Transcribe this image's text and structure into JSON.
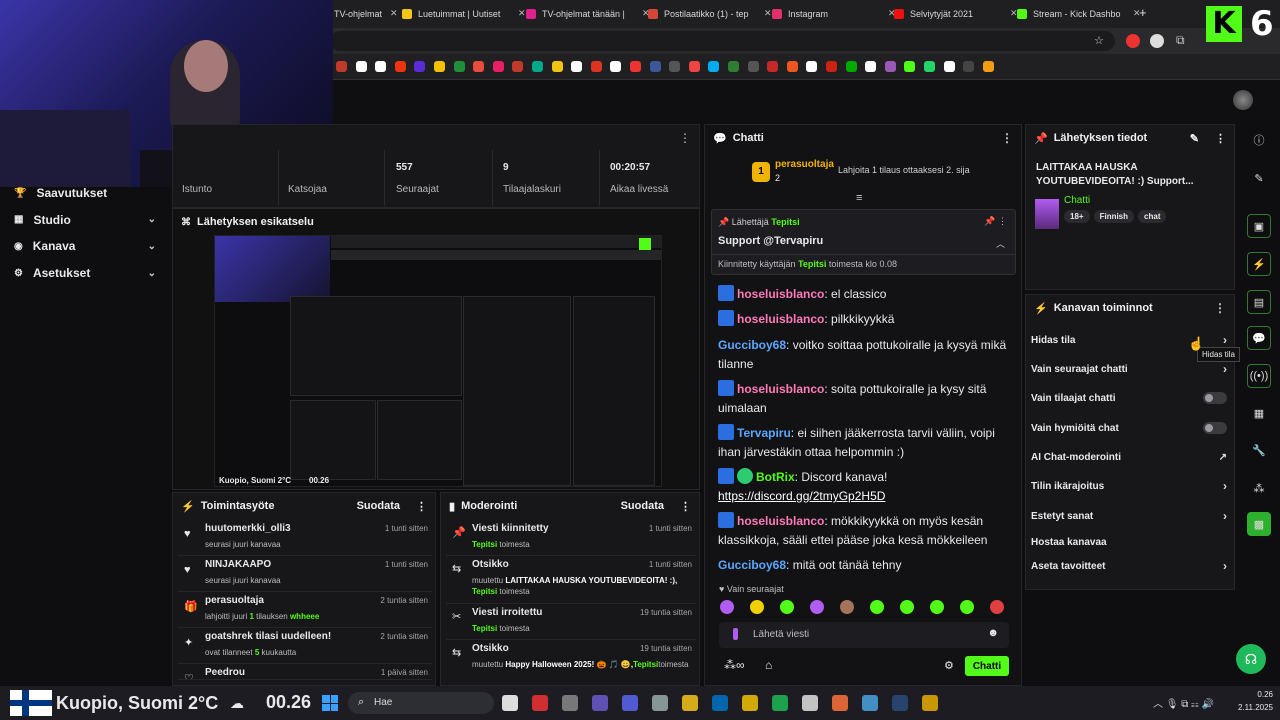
{
  "browser": {
    "tabs": [
      {
        "label": "TV-ohjelmat tänään - Ilta-Sa",
        "color": "#d33"
      },
      {
        "label": "Luetuimmat | Uutiset",
        "color": "#f5c518"
      },
      {
        "label": "TV-ohjelmat tänään |",
        "color": "#e0208c"
      },
      {
        "label": "Postilaatikko (1) - tep",
        "color": "#d44638"
      },
      {
        "label": "Instagram",
        "color": "#e1306c"
      },
      {
        "label": "Selviytyjät 2021",
        "color": "#e11"
      },
      {
        "label": "Stream - Kick Dashbo",
        "color": "#53fc18"
      }
    ],
    "new_tab": "+",
    "bookmark_colors": [
      "#c0392b",
      "#ffffff",
      "#ffffff",
      "#e31",
      "#5b2bd6",
      "#f2c200",
      "#1f8f3a",
      "#e74c3c",
      "#e91e63",
      "#c0392b",
      "#0a8",
      "#f1c40f",
      "#fff",
      "#d32",
      "#fff",
      "#e33",
      "#3b5998",
      "#555",
      "#e44",
      "#00acee",
      "#2e7d32",
      "#555",
      "#c62828",
      "#e52",
      "#fff",
      "#c21",
      "#0a0",
      "#fff",
      "#9b59b6",
      "#53fc18",
      "#25d366",
      "#fff",
      "#444",
      "#f39c12"
    ]
  },
  "kick_logo": "K",
  "kick_six": "6",
  "sidebar": {
    "items": [
      {
        "label": "Saavutukset",
        "icon": "trophy-icon"
      },
      {
        "label": "Studio",
        "icon": "grid-icon"
      },
      {
        "label": "Kanava",
        "icon": "channel-icon"
      },
      {
        "label": "Asetukset",
        "icon": "gear-icon"
      }
    ]
  },
  "stats": [
    {
      "value": "",
      "label": "Istunto"
    },
    {
      "value": "",
      "label": "Katsojaa"
    },
    {
      "value": "557",
      "label": "Seuraajat"
    },
    {
      "value": "9",
      "label": "Tilaajalaskuri"
    },
    {
      "value": "00:20:57",
      "label": "Aikaa livessä"
    }
  ],
  "preview": {
    "title": "Lähetyksen esikatselu",
    "location": "Kuopio, Suomi 2°C",
    "time": "00.26"
  },
  "activity": {
    "title": "Toimintasyöte",
    "filter": "Suodata",
    "rows": [
      {
        "title": "huutomerkki_olli3",
        "sub": "seurasi juuri kanavaa",
        "time": "1 tunti sitten"
      },
      {
        "title": "NINJAKAAPO",
        "sub": "seurasi juuri kanavaa",
        "time": "1 tunti sitten"
      },
      {
        "title": "perasuoltaja",
        "sub_a": "lahjoitti juuri ",
        "sub_b": "1",
        "sub_c": " tilauksen ",
        "sub_d": "whheee",
        "time": "2 tuntia sitten"
      },
      {
        "title": "goatshrek tilasi uudelleen!",
        "sub_a": "ovat tilanneet ",
        "sub_b": "5",
        "sub_c": " kuukautta",
        "time": "2 tuntia sitten"
      },
      {
        "title": "Peedrou",
        "time": "1 päivä sitten"
      }
    ]
  },
  "moderation": {
    "title": "Moderointi",
    "filter": "Suodata",
    "rows": [
      {
        "title": "Viesti kiinnitetty",
        "user": "Tepitsi",
        "suffix": " toimesta",
        "time": "1 tunti sitten"
      },
      {
        "title": "Otsikko",
        "pre": "muutettu ",
        "bold": "LAITTAKAA HAUSKA YOUTUBEVIDEOITA! :),",
        "user": "Tepitsi",
        "suffix": " toimesta",
        "time": "1 tunti sitten"
      },
      {
        "title": "Viesti irroitettu",
        "user": "Tepitsi",
        "suffix": " toimesta",
        "time": "19 tuntia sitten"
      },
      {
        "title": "Otsikko",
        "pre": "muutettu ",
        "bold": "Happy Halloween 2025! 🎃 🎵 😀,",
        "user": "Tepitsi",
        "suffix": "toimesta",
        "time": "19 tuntia sitten"
      }
    ]
  },
  "chat": {
    "title": "Chatti",
    "gifter_name": "perasuoltaja",
    "gifter_count": "2",
    "gift_prompt": "Lahjoita 1 tilaus ottaaksesi 2. sija",
    "pinned_by_label": "Lähettäjä",
    "pinned_user": "Tepitsi",
    "pinned_text": "Support @Tervapiru",
    "pinned_footer_a": "Kiinnitetty käyttäjän",
    "pinned_footer_b": "toimesta klo 0.08",
    "messages": [
      {
        "user": "hoseluisblanco",
        "text": "el classico",
        "cls": "u1"
      },
      {
        "user": "hoseluisblanco",
        "text": "pilkkikyykkä",
        "cls": "u1"
      },
      {
        "user": "Gucciboy68",
        "text": "voitko soittaa pottukoiralle ja kysyä mikä tilanne",
        "cls": "u2"
      },
      {
        "user": "hoseluisblanco",
        "text": "soita pottukoiralle ja kysy sitä uimalaan",
        "cls": "u1"
      },
      {
        "user": "Tervapiru",
        "text": "ei siihen jääkerrosta tarvii väliin, voipi ihan järvestäkin ottaa helpommin :)",
        "cls": "u2"
      },
      {
        "user": "BotRix",
        "text": "Discord kanava!",
        "link": "https://discord.gg/2tmyGp2H5D",
        "cls": "u3"
      },
      {
        "user": "hoseluisblanco",
        "text": "mökkikyykkä on myös kesän klassikkoja, sääli ettei pääse joka kesä mökkeileen",
        "cls": "u1"
      },
      {
        "user": "Gucciboy68",
        "text": "mitä oot tänää tehny",
        "cls": "u2"
      }
    ],
    "followers_only": "Vain seuraajat",
    "input_placeholder": "Lähetä viesti",
    "send_label": "Chatti"
  },
  "stream_info": {
    "title": "Lähetyksen tiedot",
    "stream_title": "LAITTAKAA HAUSKA YOUTUBEVIDEOITA! :) Support...",
    "category": "Chatti",
    "tags": [
      "18+",
      "Finnish",
      "chat"
    ]
  },
  "channel_actions": {
    "title": "Kanavan toiminnot",
    "rows": [
      {
        "label": "Hidas tila",
        "kind": "arrow"
      },
      {
        "label": "Vain seuraajat chatti",
        "kind": "arrow"
      },
      {
        "label": "Vain tilaajat chatti",
        "kind": "toggle"
      },
      {
        "label": "Vain hymiöitä chat",
        "kind": "toggle"
      },
      {
        "label": "AI Chat-moderointi",
        "kind": "external"
      },
      {
        "label": "Tilin ikärajoitus",
        "kind": "arrow"
      },
      {
        "label": "Estetyt sanat",
        "kind": "arrow"
      },
      {
        "label": "Hostaa kanavaa",
        "kind": "none"
      },
      {
        "label": "Aseta tavoitteet",
        "kind": "arrow"
      }
    ],
    "tooltip": "Hidas tila"
  },
  "taskbar": {
    "weather": "Kuopio, Suomi 2°C",
    "clock_big": "00.26",
    "search_placeholder": "Hae",
    "time": "0.26",
    "date": "2.11.2025"
  }
}
